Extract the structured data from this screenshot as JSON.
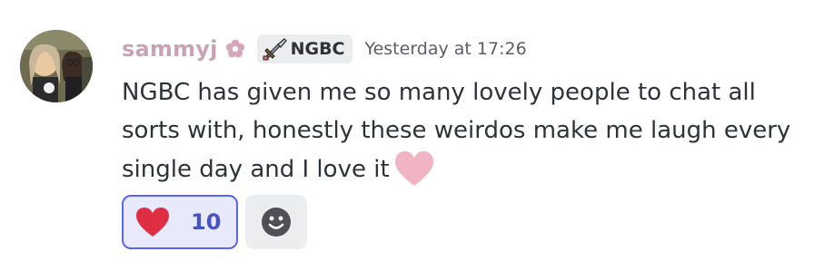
{
  "message": {
    "author": {
      "username": "sammyj",
      "username_color": "#c9a3b3",
      "decoration_icon": "flower-icon",
      "avatar_alt": "avatar"
    },
    "guild_tag": {
      "icon": "sword-icon",
      "label": "NGBC"
    },
    "timestamp": "Yesterday at 17:26",
    "content": {
      "text": "NGBC has given me so many lovely people to chat all sorts with, honestly these weirdos make me laugh every single day and I love it",
      "trailing_emoji": "pink-heart-icon"
    },
    "reactions": [
      {
        "emoji": "red-heart-icon",
        "count": "10",
        "selected": true
      }
    ],
    "add_reaction_icon": "add-reaction-smiley-icon"
  },
  "colors": {
    "accent": "#5865f2",
    "reaction_bg": "#e8eafc",
    "pink_heart": "#f0b4c2",
    "red_heart": "#dd2e44"
  }
}
